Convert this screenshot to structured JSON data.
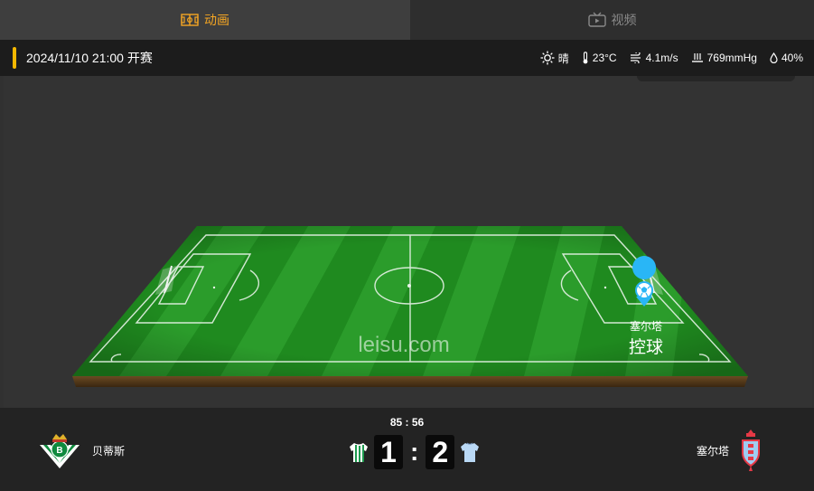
{
  "tabs": [
    {
      "label": "动画",
      "icon": "pitch-icon",
      "active": true
    },
    {
      "label": "视频",
      "icon": "tv-icon",
      "active": false
    }
  ],
  "info": {
    "kickoff": "2024/11/10 21:00 开赛",
    "weather": "晴",
    "temperature": "23°C",
    "wind": "4.1m/s",
    "pressure": "769mmHg",
    "humidity": "40%"
  },
  "field": {
    "watermark": "leisu.com",
    "possession_team": "塞尔塔",
    "possession_label": "控球"
  },
  "match": {
    "clock": "85 : 56",
    "home": {
      "name": "贝蒂斯",
      "score": "1"
    },
    "away": {
      "name": "塞尔塔",
      "score": "2"
    },
    "separator": ":"
  },
  "colors": {
    "accent": "#f5a623",
    "kickoff_bar": "#f5b800",
    "grass_dark": "#1f8a1f",
    "grass_light": "#2fa22f",
    "possession_marker": "#29b6f6"
  }
}
